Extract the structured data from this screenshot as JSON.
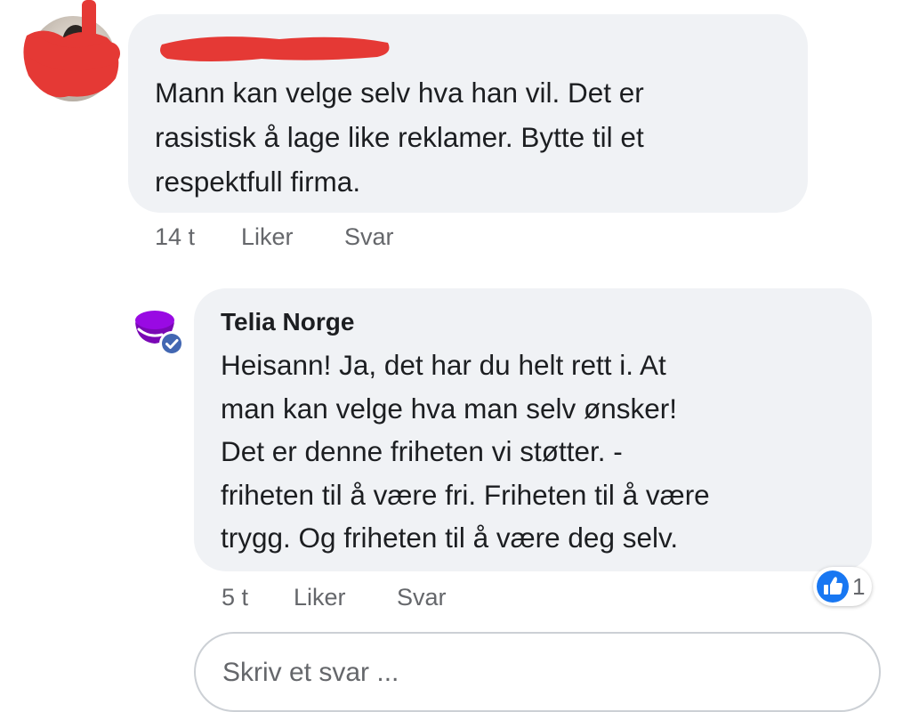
{
  "comments": [
    {
      "author": "",
      "text": "Mann kan velge selv hva han vil. Det er\nrasistisk å lage like reklamer. Bytte til et\nrespektfull firma.",
      "time": "14 t",
      "like_label": "Liker",
      "reply_label": "Svar"
    },
    {
      "author": "Telia Norge",
      "verified": true,
      "text": "Heisann!  Ja, det har du helt rett i. At\nman kan velge hva man selv ønsker!\nDet er denne friheten vi støtter. -\nfriheten til å være fri. Friheten til å være\ntrygg. Og friheten til å være deg selv.",
      "time": "5 t",
      "like_label": "Liker",
      "reply_label": "Svar",
      "reaction_count": "1",
      "reaction_icon": "thumbs-up-icon"
    }
  ],
  "reply_input": {
    "placeholder": "Skriv et svar ..."
  },
  "colors": {
    "bubble": "#f0f2f5",
    "redaction": "#e53935",
    "brand_purple": "#990ae3",
    "like_blue": "#1877f2",
    "verified_blue": "#4267b2"
  }
}
